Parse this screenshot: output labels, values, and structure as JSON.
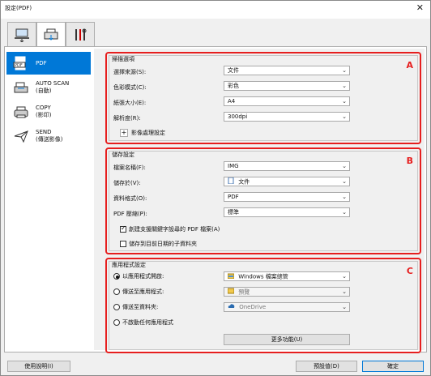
{
  "window": {
    "title": "設定(PDF)",
    "close_glyph": "✕"
  },
  "tabs": [
    {
      "icon": "scan-from-computer-icon"
    },
    {
      "icon": "scan-from-panel-icon"
    },
    {
      "icon": "general-settings-tools-icon"
    }
  ],
  "sidebar": {
    "items": [
      {
        "label": "PDF",
        "icon": "pdf-document-icon",
        "selected": true
      },
      {
        "label": "AUTO SCAN\n(自動)",
        "line1": "AUTO SCAN",
        "line2": "(自動)",
        "icon": "auto-scan-icon"
      },
      {
        "label": "COPY",
        "line1": "COPY",
        "line2": "(影印)",
        "icon": "copy-printer-icon"
      },
      {
        "label": "SEND",
        "line1": "SEND",
        "line2": "(傳送影像)",
        "icon": "send-image-icon"
      }
    ]
  },
  "scan_options": {
    "title": "掃描選項",
    "marker": "A",
    "source_label": "選擇來源(S):",
    "source_value": "文件",
    "color_label": "色彩模式(C):",
    "color_value": "彩色",
    "paper_label": "紙張大小(E):",
    "paper_value": "A4",
    "resolution_label": "解析度(R):",
    "resolution_value": "300dpi",
    "image_processing_label": "影像處理設定",
    "expand_glyph": "+"
  },
  "save_settings": {
    "title": "儲存設定",
    "marker": "B",
    "filename_label": "檔案名稱(F):",
    "filename_value": "IMG",
    "savein_label": "儲存於(V):",
    "savein_value": "文件",
    "format_label": "資料格式(O):",
    "format_value": "PDF",
    "compression_label": "PDF 壓縮(P):",
    "compression_value": "標準",
    "searchable_label": "創建支援關鍵字設尋的 PDF 檔案(A)",
    "searchable_checked": true,
    "subfolder_label": "儲存到目前日期的子資料夾",
    "subfolder_checked": false
  },
  "app_settings": {
    "title": "應用程式設定",
    "marker": "C",
    "open_with_label": "以應用程式開啟:",
    "open_with_value": "Windows 檔案總管",
    "send_to_app_label": "傳送至應用程式:",
    "send_to_app_value": "預覽",
    "send_to_folder_label": "傳送至資料夾:",
    "send_to_folder_value": "OneDrive",
    "do_not_start_label": "不啟動任何應用程式",
    "more_functions_label": "更多功能(U)",
    "selected_option": "open_with"
  },
  "footer": {
    "instructions_label": "使用說明(I)",
    "defaults_label": "預設值(D)",
    "ok_label": "確定"
  },
  "colors": {
    "accent": "#0078d7",
    "marker_red": "#e61e1e"
  }
}
